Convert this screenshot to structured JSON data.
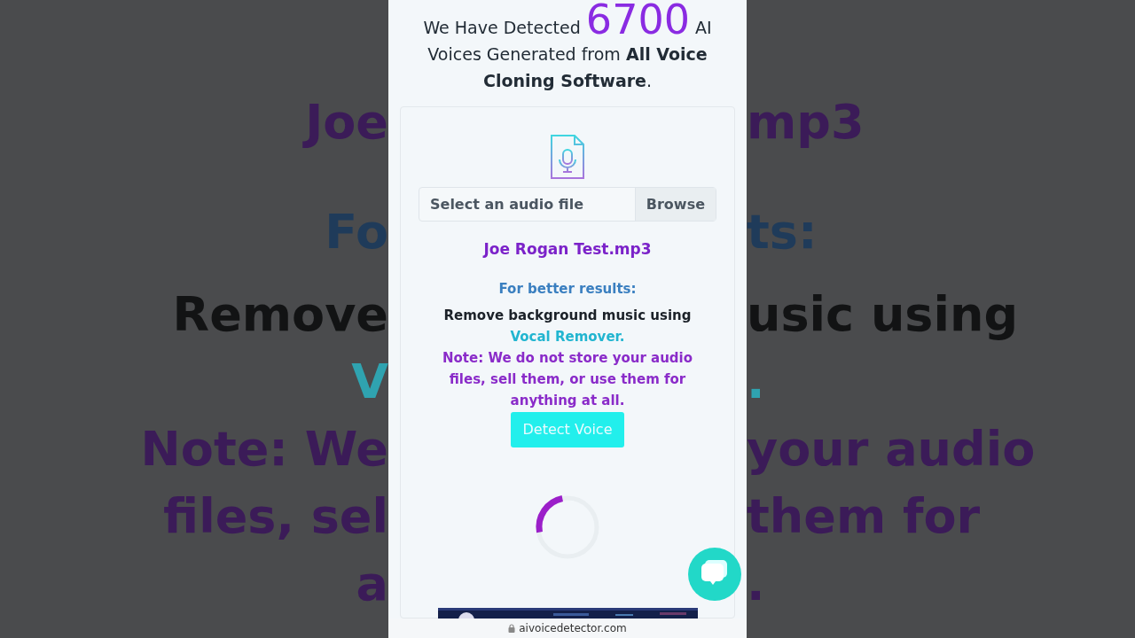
{
  "backdrop": {
    "rows": [
      {
        "left": "Joe",
        "right": "mp3",
        "color": "#3b1b58"
      },
      {
        "left": "Fo",
        "right": "ts:",
        "color": "#1f3b5a"
      },
      {
        "left": "Remove",
        "right": "usic using",
        "color": "#121314"
      },
      {
        "left": "V",
        "right": ".",
        "color": "#2fa3b0"
      },
      {
        "left": "Note: We",
        "right": "your audio",
        "color": "#3b1b58"
      },
      {
        "left": "files, sel",
        "right": "them for",
        "color": "#3b1b58"
      },
      {
        "left": "a",
        "right": ".",
        "color": "#3b1b58"
      }
    ]
  },
  "headline": {
    "before": "We Have Detected",
    "count": "6700",
    "after": "AI Voices Generated from **All Voice Cloning Software**."
  },
  "upload": {
    "placeholder": "Select an audio file",
    "browse": "Browse",
    "file_name": "Joe Rogan Test.mp3"
  },
  "tips": {
    "title": "For better results:",
    "text": "Remove background music using",
    "link": "Vocal Remover.",
    "note": "Note: We do not store your audio files, sell them, or use them for anything at all."
  },
  "detect_button": "Detect Voice",
  "address_bar": {
    "url": "aivoicedetector.com"
  }
}
